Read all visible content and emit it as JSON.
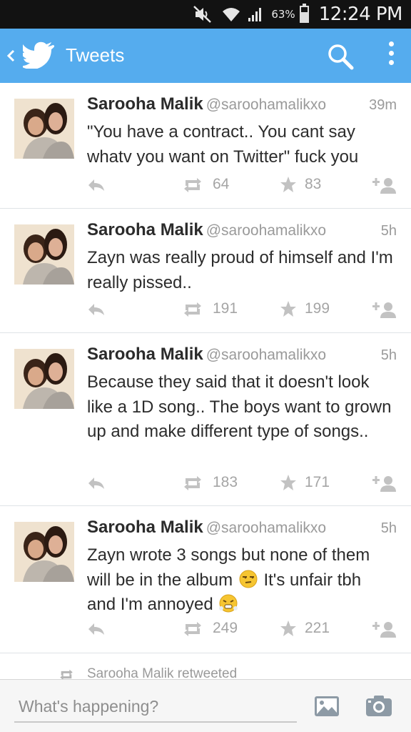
{
  "status_bar": {
    "battery_percent": "63%",
    "battery_level": 0.63,
    "time": "12:24 PM",
    "icons": [
      "mute-icon",
      "wifi-icon",
      "signal-icon",
      "battery-icon"
    ]
  },
  "action_bar": {
    "title": "Tweets",
    "color": "#55acee",
    "icons": [
      "back-chevron-icon",
      "twitter-bird-icon",
      "search-icon",
      "overflow-menu-icon"
    ]
  },
  "tweets": [
    {
      "name": "Sarooha Malik",
      "handle": "@saroohamalikxo",
      "time": "39m",
      "text": "\"You have a contract.. You cant say whatv you want on Twitter\" fuck you",
      "retweets": "64",
      "favorites": "83"
    },
    {
      "name": "Sarooha Malik",
      "handle": "@saroohamalikxo",
      "time": "5h",
      "text": "Zayn was really proud of himself and I'm really pissed..",
      "retweets": "191",
      "favorites": "199"
    },
    {
      "name": "Sarooha Malik",
      "handle": "@saroohamalikxo",
      "time": "5h",
      "text": "Because they said that it doesn't look like a 1D song.. The boys want to grown up and make different type of songs..",
      "retweets": "183",
      "favorites": "171"
    },
    {
      "name": "Sarooha Malik",
      "handle": "@saroohamalikxo",
      "time": "5h",
      "text_part1": "Zayn wrote 3 songs but none of them will be in the album",
      "text_part2": "It's unfair tbh and I'm annoyed",
      "retweets": "249",
      "favorites": "221"
    }
  ],
  "retweet_context": "Sarooha Malik retweeted",
  "compose": {
    "placeholder": "What's happening?",
    "icons": [
      "photo-icon",
      "camera-icon"
    ]
  }
}
